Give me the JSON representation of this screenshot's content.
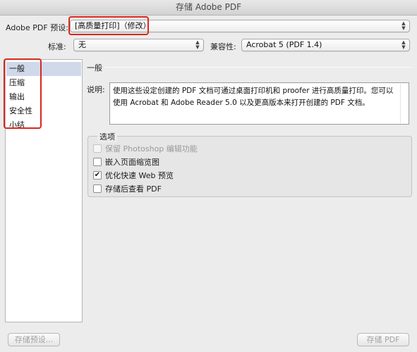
{
  "window": {
    "title": "存储 Adobe PDF"
  },
  "preset": {
    "label": "Adobe PDF 预设:",
    "value": "[高质量打印]（修改）"
  },
  "standard": {
    "label": "标准:",
    "value": "无"
  },
  "compatibility": {
    "label": "兼容性:",
    "value": "Acrobat 5 (PDF 1.4)"
  },
  "sidebar": {
    "items": [
      {
        "label": "一般",
        "selected": true
      },
      {
        "label": "压缩",
        "selected": false
      },
      {
        "label": "输出",
        "selected": false
      },
      {
        "label": "安全性",
        "selected": false
      },
      {
        "label": "小结",
        "selected": false
      }
    ]
  },
  "general": {
    "title": "一般",
    "description_label": "说明:",
    "description": "使用这些设定创建的 PDF 文档可通过桌面打印机和 proofer 进行高质量打印。您可以使用 Acrobat 和 Adobe Reader 5.0 以及更高版本来打开创建的 PDF 文档。"
  },
  "options": {
    "title": "选项",
    "items": [
      {
        "label": "保留 Photoshop 编辑功能",
        "checked": false,
        "disabled": true
      },
      {
        "label": "嵌入页面缩览图",
        "checked": false,
        "disabled": false
      },
      {
        "label": "优化快速 Web 预览",
        "checked": true,
        "disabled": false
      },
      {
        "label": "存储后查看 PDF",
        "checked": false,
        "disabled": false
      }
    ]
  },
  "buttons": {
    "save_preset": "存储预设...",
    "save_pdf": "存储 PDF"
  },
  "colors": {
    "highlight_box": "#d8281e",
    "selection": "#d0d9ea"
  }
}
